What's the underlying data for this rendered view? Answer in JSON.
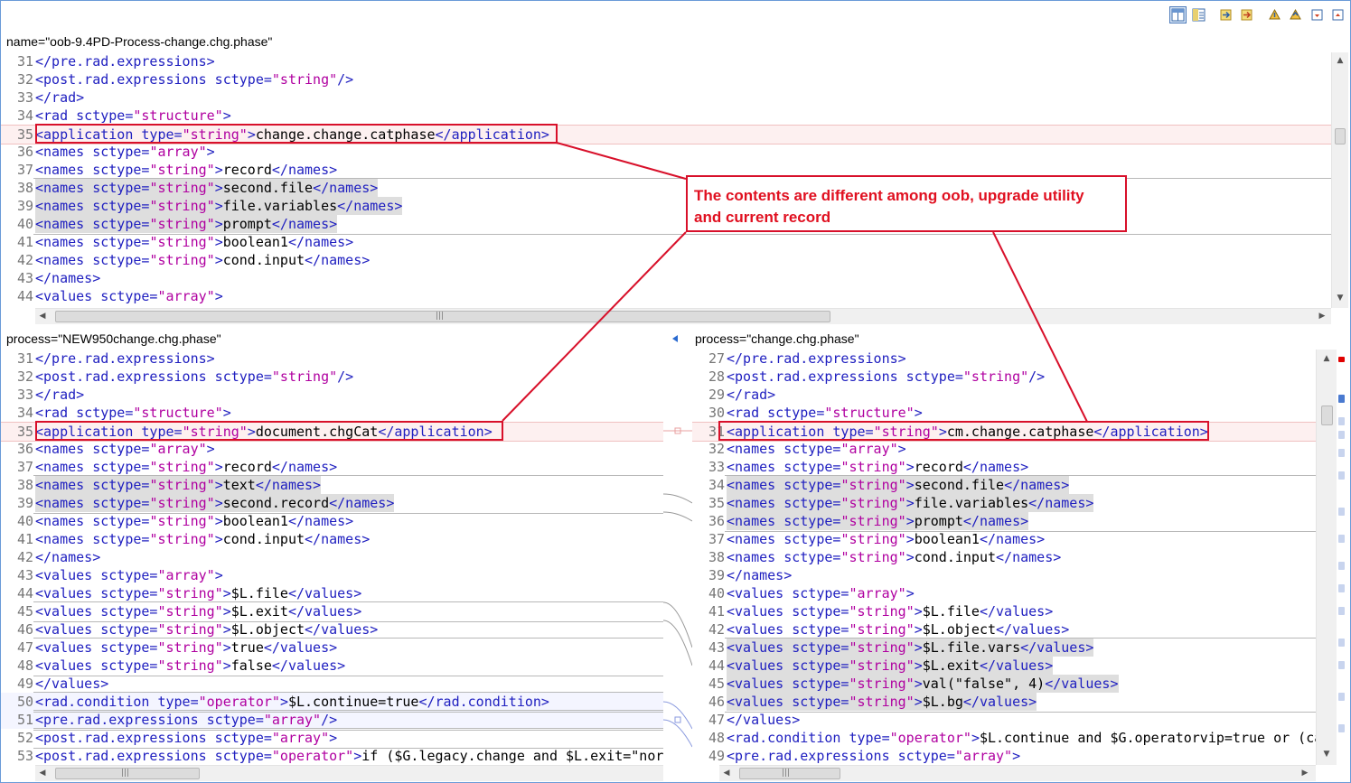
{
  "toolbar": {
    "icons": [
      "layout-toggle-icon",
      "layout-split-icon",
      "copy-left-icon",
      "copy-right-icon",
      "next-diff-icon",
      "previous-diff-icon",
      "next-change-icon",
      "previous-change-icon"
    ]
  },
  "top_pane": {
    "title": "name=\"oob-9.4PD-Process-change.chg.phase\"",
    "lines": [
      {
        "n": "31",
        "text": "</pre.rad.expressions>"
      },
      {
        "n": "32",
        "text": "<post.rad.expressions sctype=\"string\"/>"
      },
      {
        "n": "33",
        "text": "</rad>"
      },
      {
        "n": "34",
        "text": "<rad sctype=\"structure\">"
      },
      {
        "n": "35",
        "text": "<application type=\"string\">change.change.catphase</application>"
      },
      {
        "n": "36",
        "text": "<names sctype=\"array\">"
      },
      {
        "n": "37",
        "text": "<names sctype=\"string\">record</names>"
      },
      {
        "n": "38",
        "text": "<names sctype=\"string\">second.file</names>"
      },
      {
        "n": "39",
        "text": "<names sctype=\"string\">file.variables</names>"
      },
      {
        "n": "40",
        "text": "<names sctype=\"string\">prompt</names>"
      },
      {
        "n": "41",
        "text": "<names sctype=\"string\">boolean1</names>"
      },
      {
        "n": "42",
        "text": "<names sctype=\"string\">cond.input</names>"
      },
      {
        "n": "43",
        "text": "</names>"
      },
      {
        "n": "44",
        "text": "<values sctype=\"array\">"
      }
    ]
  },
  "left_pane": {
    "title": "process=\"NEW950change.chg.phase\"",
    "lines": [
      {
        "n": "31",
        "text": "</pre.rad.expressions>"
      },
      {
        "n": "32",
        "text": "<post.rad.expressions sctype=\"string\"/>"
      },
      {
        "n": "33",
        "text": "</rad>"
      },
      {
        "n": "34",
        "text": "<rad sctype=\"structure\">"
      },
      {
        "n": "35",
        "text": "<application type=\"string\">document.chgCat</application>"
      },
      {
        "n": "36",
        "text": "<names sctype=\"array\">"
      },
      {
        "n": "37",
        "text": "<names sctype=\"string\">record</names>"
      },
      {
        "n": "38",
        "text": "<names sctype=\"string\">text</names>"
      },
      {
        "n": "39",
        "text": "<names sctype=\"string\">second.record</names>"
      },
      {
        "n": "40",
        "text": "<names sctype=\"string\">boolean1</names>"
      },
      {
        "n": "41",
        "text": "<names sctype=\"string\">cond.input</names>"
      },
      {
        "n": "42",
        "text": "</names>"
      },
      {
        "n": "43",
        "text": "<values sctype=\"array\">"
      },
      {
        "n": "44",
        "text": "<values sctype=\"string\">$L.file</values>"
      },
      {
        "n": "45",
        "text": "<values sctype=\"string\">$L.exit</values>"
      },
      {
        "n": "46",
        "text": "<values sctype=\"string\">$L.object</values>"
      },
      {
        "n": "47",
        "text": "<values sctype=\"string\">true</values>"
      },
      {
        "n": "48",
        "text": "<values sctype=\"string\">false</values>"
      },
      {
        "n": "49",
        "text": "</values>"
      },
      {
        "n": "50",
        "text": "<rad.condition type=\"operator\">$L.continue=true</rad.condition>"
      },
      {
        "n": "51",
        "text": "<pre.rad.expressions sctype=\"array\"/>"
      },
      {
        "n": "52",
        "text": "<post.rad.expressions sctype=\"array\">"
      },
      {
        "n": "53",
        "text": "<post.rad.expressions sctype=\"operator\">if ($G.legacy.change and $L.exit=\"nor"
      }
    ]
  },
  "right_pane": {
    "title": "process=\"change.chg.phase\"",
    "lines": [
      {
        "n": "27",
        "text": "</pre.rad.expressions>"
      },
      {
        "n": "28",
        "text": "<post.rad.expressions sctype=\"string\"/>"
      },
      {
        "n": "29",
        "text": "</rad>"
      },
      {
        "n": "30",
        "text": "<rad sctype=\"structure\">"
      },
      {
        "n": "31",
        "text": "<application type=\"string\">cm.change.catphase</application>"
      },
      {
        "n": "32",
        "text": "<names sctype=\"array\">"
      },
      {
        "n": "33",
        "text": "<names sctype=\"string\">record</names>"
      },
      {
        "n": "34",
        "text": "<names sctype=\"string\">second.file</names>"
      },
      {
        "n": "35",
        "text": "<names sctype=\"string\">file.variables</names>"
      },
      {
        "n": "36",
        "text": "<names sctype=\"string\">prompt</names>"
      },
      {
        "n": "37",
        "text": "<names sctype=\"string\">boolean1</names>"
      },
      {
        "n": "38",
        "text": "<names sctype=\"string\">cond.input</names>"
      },
      {
        "n": "39",
        "text": "</names>"
      },
      {
        "n": "40",
        "text": "<values sctype=\"array\">"
      },
      {
        "n": "41",
        "text": "<values sctype=\"string\">$L.file</values>"
      },
      {
        "n": "42",
        "text": "<values sctype=\"string\">$L.object</values>"
      },
      {
        "n": "43",
        "text": "<values sctype=\"string\">$L.file.vars</values>"
      },
      {
        "n": "44",
        "text": "<values sctype=\"string\">$L.exit</values>"
      },
      {
        "n": "45",
        "text": "<values sctype=\"string\">val(\"false\", 4)</values>"
      },
      {
        "n": "46",
        "text": "<values sctype=\"string\">$L.bg</values>"
      },
      {
        "n": "47",
        "text": "</values>"
      },
      {
        "n": "48",
        "text": "<rad.condition type=\"operator\">$L.continue and $G.operatorvip=true or (ca"
      },
      {
        "n": "49",
        "text": "<pre.rad.expressions sctype=\"array\">"
      }
    ]
  },
  "annotation": {
    "line1": "The contents are different among oob, upgrade utility",
    "line2": "and current record"
  },
  "colors": {
    "tag": "#2020c0",
    "value": "#b000a0",
    "annotation": "#d8102a",
    "highlight": "#dedede"
  }
}
